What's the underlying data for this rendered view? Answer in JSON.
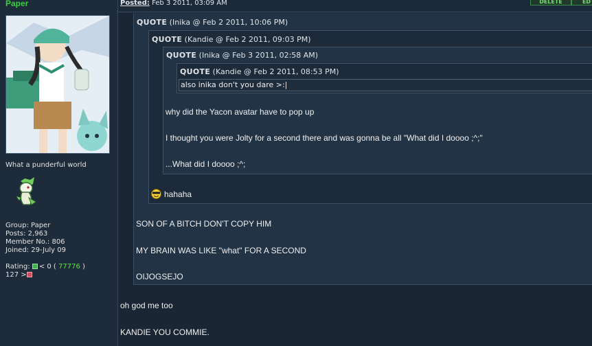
{
  "user": {
    "name": "Paper",
    "title": "What a punderful world",
    "stats": {
      "group": "Group: Paper",
      "posts": "Posts: 2,963",
      "member_no": "Member No.: 806",
      "joined": "Joined: 29-July 09",
      "rating_label": "Rating:",
      "rating_mid": "< 0 (",
      "rating_value": "77776",
      "rating_close": ")",
      "rating_second": "127 >"
    }
  },
  "post": {
    "posted_label": "Posted:",
    "posted_date": "Feb 3 2011, 03:09 AM",
    "buttons": {
      "delete": "DELETE",
      "edit": "ED"
    }
  },
  "quotes": {
    "q1": {
      "label": "QUOTE",
      "meta": "(Inika @ Feb 2 2011, 10:06 PM)"
    },
    "q2": {
      "label": "QUOTE",
      "meta": "(Kandie @ Feb 2 2011, 09:03 PM)"
    },
    "q3": {
      "label": "QUOTE",
      "meta": "(Inika @ Feb 3 2011, 02:58 AM)"
    },
    "q4": {
      "label": "QUOTE",
      "meta": "(Kandie @ Feb 2 2011, 08:53 PM)",
      "text": "also inika don't you dare >:|"
    }
  },
  "lines": {
    "q3_1": "why did the Yacon avatar have to pop up",
    "q3_2": "I thought you were Jolty for a second there and was gonna be all \"What did I doooo ;^;\"",
    "q3_3": "...What did I doooo ;^;",
    "q2_1": "hahaha",
    "q1_1": "SON OF A BITCH DON'T COPY HIM",
    "q1_2": "MY BRAIN WAS LIKE \"what\" FOR A SECOND",
    "q1_3": "OIJOGSEJO",
    "main_1": "oh god me too",
    "main_2": "KANDIE YOU COMMIE."
  },
  "colors": {
    "username": "#39d13b",
    "background": "#1a2634",
    "rating_value": "#5ce043"
  },
  "icons": [
    "avatar-image",
    "snivy-sprite",
    "cool-smiley-icon",
    "rating-up-icon",
    "rating-down-icon"
  ]
}
